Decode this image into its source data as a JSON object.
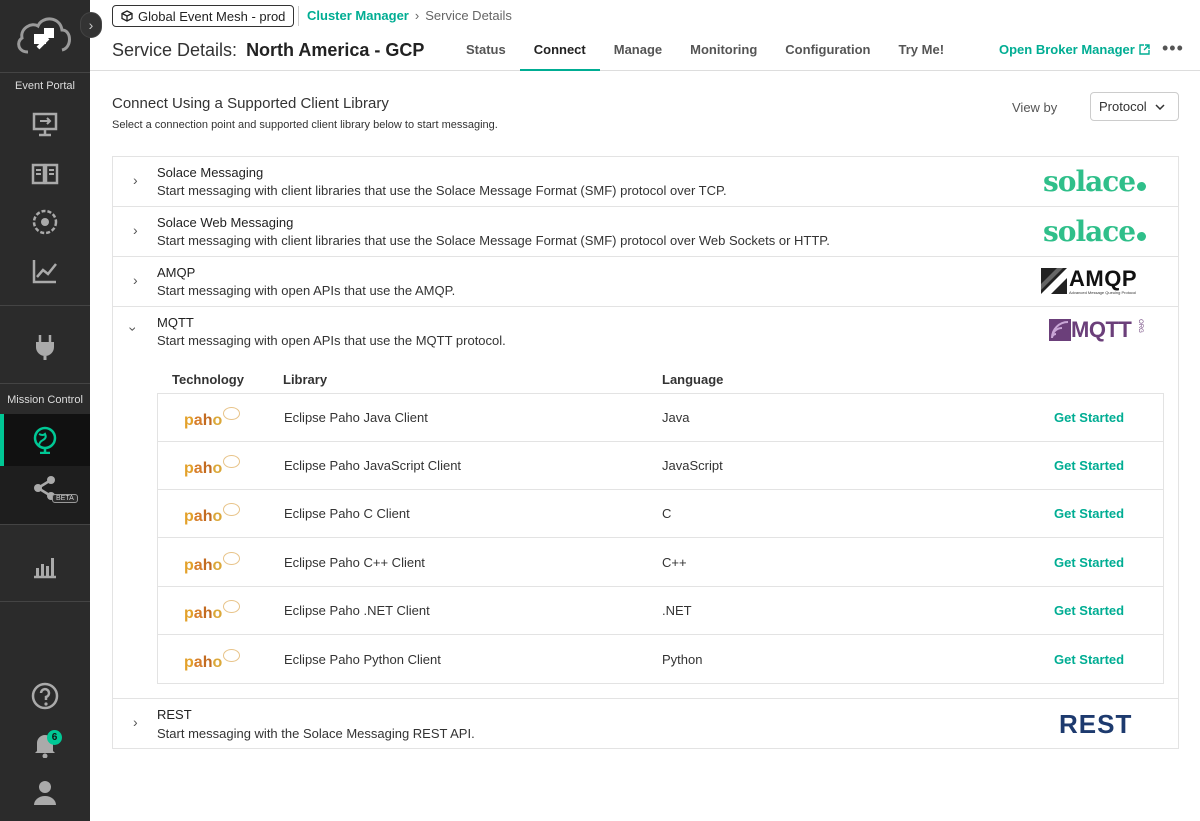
{
  "sidebar": {
    "collapse_icon": "chevron-right-icon",
    "event_portal_label": "Event Portal",
    "mission_control_label": "Mission Control",
    "beta_label": "BETA",
    "notification_count": "6",
    "accent_color": "#00c895"
  },
  "header": {
    "mesh_chip": "Global Event Mesh - prod",
    "breadcrumb_link": "Cluster Manager",
    "breadcrumb_current": "Service Details",
    "title_prefix": "Service Details:",
    "title_name": "North America - GCP",
    "tabs": [
      {
        "label": "Status"
      },
      {
        "label": "Connect"
      },
      {
        "label": "Manage"
      },
      {
        "label": "Monitoring"
      },
      {
        "label": "Configuration"
      },
      {
        "label": "Try Me!"
      }
    ],
    "active_tab": "Connect",
    "open_broker": "Open Broker Manager",
    "more": "•••"
  },
  "content": {
    "title": "Connect Using a Supported Client Library",
    "subtitle": "Select a connection point and supported client library below to start messaging.",
    "view_by_label": "View by",
    "view_by_value": "Protocol"
  },
  "protocols": [
    {
      "title": "Solace Messaging",
      "desc": "Start messaging with client libraries that use the Solace Message Format (SMF) protocol over TCP.",
      "logo": "solace"
    },
    {
      "title": "Solace Web Messaging",
      "desc": "Start messaging with client libraries that use the Solace Message Format (SMF) protocol over Web Sockets or HTTP.",
      "logo": "solace"
    },
    {
      "title": "AMQP",
      "desc": "Start messaging with open APIs that use the AMQP.",
      "logo_text": "AMQP",
      "logo_sub": "Advanced Message Queuing Protocol"
    },
    {
      "title": "MQTT",
      "desc": "Start messaging with open APIs that use the MQTT protocol.",
      "logo_text": "MQTT",
      "logo_sub": "ORG"
    },
    {
      "title": "REST",
      "desc": "Start messaging with the Solace Messaging REST API.",
      "logo_text": "REST"
    }
  ],
  "mqtt_table": {
    "headers": {
      "technology": "Technology",
      "library": "Library",
      "language": "Language"
    },
    "tech_logo": "paho",
    "action": "Get Started",
    "rows": [
      {
        "library": "Eclipse Paho Java Client",
        "language": "Java"
      },
      {
        "library": "Eclipse Paho JavaScript Client",
        "language": "JavaScript"
      },
      {
        "library": "Eclipse Paho C Client",
        "language": "C"
      },
      {
        "library": "Eclipse Paho C++ Client",
        "language": "C++"
      },
      {
        "library": "Eclipse Paho .NET Client",
        "language": ".NET"
      },
      {
        "library": "Eclipse Paho Python Client",
        "language": "Python"
      }
    ]
  }
}
